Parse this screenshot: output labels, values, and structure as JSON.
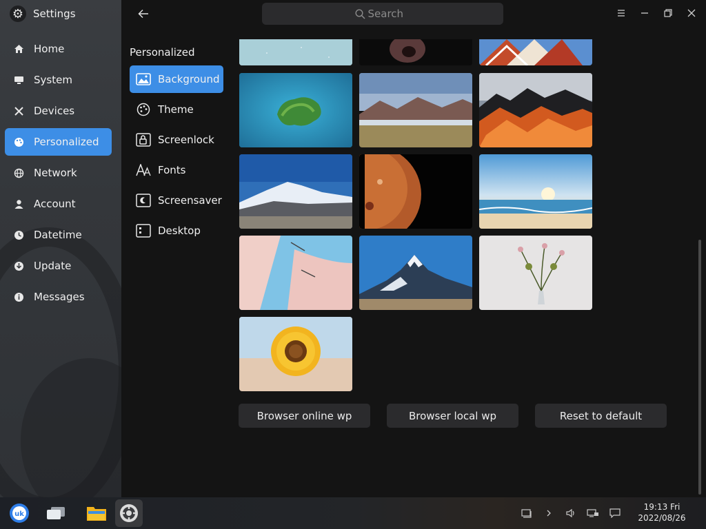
{
  "app": {
    "title": "Settings"
  },
  "nav": {
    "items": [
      {
        "label": "Home",
        "icon": "home-icon"
      },
      {
        "label": "System",
        "icon": "monitor-icon"
      },
      {
        "label": "Devices",
        "icon": "devices-icon"
      },
      {
        "label": "Personalized",
        "icon": "palette-icon",
        "active": true
      },
      {
        "label": "Network",
        "icon": "globe-icon"
      },
      {
        "label": "Account",
        "icon": "user-icon"
      },
      {
        "label": "Datetime",
        "icon": "clock-icon"
      },
      {
        "label": "Update",
        "icon": "update-icon"
      },
      {
        "label": "Messages",
        "icon": "info-icon"
      }
    ]
  },
  "subnav": {
    "title": "Personalized",
    "items": [
      {
        "label": "Background",
        "icon": "image-icon",
        "active": true
      },
      {
        "label": "Theme",
        "icon": "palette-icon"
      },
      {
        "label": "Screenlock",
        "icon": "screenlock-icon"
      },
      {
        "label": "Fonts",
        "icon": "fonts-icon"
      },
      {
        "label": "Screensaver",
        "icon": "screensaver-icon"
      },
      {
        "label": "Desktop",
        "icon": "desktop-icon"
      }
    ]
  },
  "search": {
    "placeholder": "Search"
  },
  "actions": {
    "online": "Browser online wp",
    "local": "Browser local wp",
    "reset": "Reset to default"
  },
  "taskbar": {
    "time": "19:13 Fri",
    "date": "2022/08/26"
  },
  "colors": {
    "accent": "#3d8ee6",
    "background": "#141414",
    "button": "#2b2b2d"
  }
}
